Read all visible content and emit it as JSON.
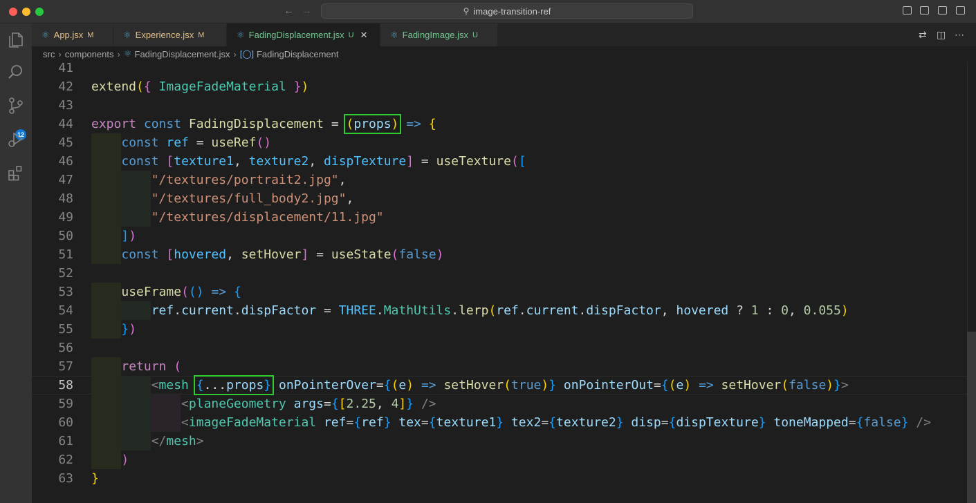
{
  "window": {
    "search": "image-transition-ref"
  },
  "activity_badge": "12",
  "tabs": [
    {
      "name": "App.jsx",
      "status": "M",
      "kind": "modified",
      "active": false
    },
    {
      "name": "Experience.jsx",
      "status": "M",
      "kind": "modified",
      "active": false
    },
    {
      "name": "FadingDisplacement.jsx",
      "status": "U",
      "kind": "untracked",
      "active": true
    },
    {
      "name": "FadingImage.jsx",
      "status": "U",
      "kind": "untracked",
      "active": false
    }
  ],
  "breadcrumb": [
    "src",
    "components",
    "FadingDisplacement.jsx",
    "FadingDisplacement"
  ],
  "line_numbers": [
    "41",
    "42",
    "43",
    "44",
    "45",
    "46",
    "47",
    "48",
    "49",
    "50",
    "51",
    "52",
    "53",
    "54",
    "55",
    "56",
    "57",
    "58",
    "59",
    "60",
    "61",
    "62",
    "63"
  ],
  "current_line": "58",
  "code_lines": [
    [],
    [
      [
        "fn",
        "extend"
      ],
      [
        "b1",
        "("
      ],
      [
        "b2",
        "{"
      ],
      [
        "pl",
        " "
      ],
      [
        "ty",
        "ImageFadeMaterial"
      ],
      [
        "pl",
        " "
      ],
      [
        "b2",
        "}"
      ],
      [
        "b1",
        ")"
      ]
    ],
    [],
    [
      [
        "kw",
        "export"
      ],
      [
        "pl",
        " "
      ],
      [
        "st",
        "const"
      ],
      [
        "pl",
        " "
      ],
      [
        "fn",
        "FadingDisplacement"
      ],
      [
        "pl",
        " = "
      ],
      [
        "b1",
        "("
      ],
      [
        "vr",
        "props"
      ],
      [
        "b1",
        ")"
      ],
      [
        "pl",
        " "
      ],
      [
        "st",
        "=>"
      ],
      [
        "pl",
        " "
      ],
      [
        "b1",
        "{"
      ]
    ],
    [
      [
        "pl",
        "    "
      ],
      [
        "st",
        "const"
      ],
      [
        "pl",
        " "
      ],
      [
        "cn",
        "ref"
      ],
      [
        "pl",
        " = "
      ],
      [
        "fn",
        "useRef"
      ],
      [
        "b2",
        "()"
      ]
    ],
    [
      [
        "pl",
        "    "
      ],
      [
        "st",
        "const"
      ],
      [
        "pl",
        " "
      ],
      [
        "b2",
        "["
      ],
      [
        "cn",
        "texture1"
      ],
      [
        "pl",
        ", "
      ],
      [
        "cn",
        "texture2"
      ],
      [
        "pl",
        ", "
      ],
      [
        "cn",
        "dispTexture"
      ],
      [
        "b2",
        "]"
      ],
      [
        "pl",
        " = "
      ],
      [
        "fn",
        "useTexture"
      ],
      [
        "b2",
        "("
      ],
      [
        "b3",
        "["
      ]
    ],
    [
      [
        "pl",
        "        "
      ],
      [
        "s",
        "\"/textures/portrait2.jpg\""
      ],
      [
        "pl",
        ","
      ]
    ],
    [
      [
        "pl",
        "        "
      ],
      [
        "s",
        "\"/textures/full_body2.jpg\""
      ],
      [
        "pl",
        ","
      ]
    ],
    [
      [
        "pl",
        "        "
      ],
      [
        "s",
        "\"/textures/displacement/11.jpg\""
      ]
    ],
    [
      [
        "pl",
        "    "
      ],
      [
        "b3",
        "]"
      ],
      [
        "b2",
        ")"
      ]
    ],
    [
      [
        "pl",
        "    "
      ],
      [
        "st",
        "const"
      ],
      [
        "pl",
        " "
      ],
      [
        "b2",
        "["
      ],
      [
        "cn",
        "hovered"
      ],
      [
        "pl",
        ", "
      ],
      [
        "fn",
        "setHover"
      ],
      [
        "b2",
        "]"
      ],
      [
        "pl",
        " = "
      ],
      [
        "fn",
        "useState"
      ],
      [
        "b2",
        "("
      ],
      [
        "bo",
        "false"
      ],
      [
        "b2",
        ")"
      ]
    ],
    [],
    [
      [
        "pl",
        "    "
      ],
      [
        "fn",
        "useFrame"
      ],
      [
        "b2",
        "("
      ],
      [
        "b3",
        "()"
      ],
      [
        "pl",
        " "
      ],
      [
        "st",
        "=>"
      ],
      [
        "pl",
        " "
      ],
      [
        "b3",
        "{"
      ]
    ],
    [
      [
        "pl",
        "        "
      ],
      [
        "vr",
        "ref"
      ],
      [
        "pl",
        "."
      ],
      [
        "vr",
        "current"
      ],
      [
        "pl",
        "."
      ],
      [
        "vr",
        "dispFactor"
      ],
      [
        "pl",
        " = "
      ],
      [
        "cn",
        "THREE"
      ],
      [
        "pl",
        "."
      ],
      [
        "ty",
        "MathUtils"
      ],
      [
        "pl",
        "."
      ],
      [
        "fn",
        "lerp"
      ],
      [
        "b1",
        "("
      ],
      [
        "vr",
        "ref"
      ],
      [
        "pl",
        "."
      ],
      [
        "vr",
        "current"
      ],
      [
        "pl",
        "."
      ],
      [
        "vr",
        "dispFactor"
      ],
      [
        "pl",
        ", "
      ],
      [
        "vr",
        "hovered"
      ],
      [
        "pl",
        " ? "
      ],
      [
        "nm",
        "1"
      ],
      [
        "pl",
        " : "
      ],
      [
        "nm",
        "0"
      ],
      [
        "pl",
        ", "
      ],
      [
        "nm",
        "0.055"
      ],
      [
        "b1",
        ")"
      ]
    ],
    [
      [
        "pl",
        "    "
      ],
      [
        "b3",
        "}"
      ],
      [
        "b2",
        ")"
      ]
    ],
    [],
    [
      [
        "pl",
        "    "
      ],
      [
        "kw",
        "return"
      ],
      [
        "pl",
        " "
      ],
      [
        "b2",
        "("
      ]
    ],
    [
      [
        "pl",
        "        "
      ],
      [
        "ang",
        "<"
      ],
      [
        "tg",
        "mesh"
      ],
      [
        "pl",
        " "
      ],
      [
        "b3",
        "{"
      ],
      [
        "pl",
        "..."
      ],
      [
        "vr",
        "props"
      ],
      [
        "b3",
        "}"
      ],
      [
        "pl",
        " "
      ],
      [
        "at",
        "onPointerOver"
      ],
      [
        "pl",
        "="
      ],
      [
        "b3",
        "{"
      ],
      [
        "b1",
        "("
      ],
      [
        "vr",
        "e"
      ],
      [
        "b1",
        ")"
      ],
      [
        "pl",
        " "
      ],
      [
        "st",
        "=>"
      ],
      [
        "pl",
        " "
      ],
      [
        "fn",
        "setHover"
      ],
      [
        "b1",
        "("
      ],
      [
        "bo",
        "true"
      ],
      [
        "b1",
        ")"
      ],
      [
        "b3",
        "}"
      ],
      [
        "pl",
        " "
      ],
      [
        "at",
        "onPointerOut"
      ],
      [
        "pl",
        "="
      ],
      [
        "b3",
        "{"
      ],
      [
        "b1",
        "("
      ],
      [
        "vr",
        "e"
      ],
      [
        "b1",
        ")"
      ],
      [
        "pl",
        " "
      ],
      [
        "st",
        "=>"
      ],
      [
        "pl",
        " "
      ],
      [
        "fn",
        "setHover"
      ],
      [
        "b1",
        "("
      ],
      [
        "bo",
        "false"
      ],
      [
        "b1",
        ")"
      ],
      [
        "b3",
        "}"
      ],
      [
        "ang",
        ">"
      ]
    ],
    [
      [
        "pl",
        "            "
      ],
      [
        "ang",
        "<"
      ],
      [
        "tg",
        "planeGeometry"
      ],
      [
        "pl",
        " "
      ],
      [
        "at",
        "args"
      ],
      [
        "pl",
        "="
      ],
      [
        "b3",
        "{"
      ],
      [
        "b1",
        "["
      ],
      [
        "nm",
        "2.25"
      ],
      [
        "pl",
        ", "
      ],
      [
        "nm",
        "4"
      ],
      [
        "b1",
        "]"
      ],
      [
        "b3",
        "}"
      ],
      [
        "pl",
        " "
      ],
      [
        "ang",
        "/>"
      ]
    ],
    [
      [
        "pl",
        "            "
      ],
      [
        "ang",
        "<"
      ],
      [
        "tg",
        "imageFadeMaterial"
      ],
      [
        "pl",
        " "
      ],
      [
        "at",
        "ref"
      ],
      [
        "pl",
        "="
      ],
      [
        "b3",
        "{"
      ],
      [
        "vr",
        "ref"
      ],
      [
        "b3",
        "}"
      ],
      [
        "pl",
        " "
      ],
      [
        "at",
        "tex"
      ],
      [
        "pl",
        "="
      ],
      [
        "b3",
        "{"
      ],
      [
        "vr",
        "texture1"
      ],
      [
        "b3",
        "}"
      ],
      [
        "pl",
        " "
      ],
      [
        "at",
        "tex2"
      ],
      [
        "pl",
        "="
      ],
      [
        "b3",
        "{"
      ],
      [
        "vr",
        "texture2"
      ],
      [
        "b3",
        "}"
      ],
      [
        "pl",
        " "
      ],
      [
        "at",
        "disp"
      ],
      [
        "pl",
        "="
      ],
      [
        "b3",
        "{"
      ],
      [
        "vr",
        "dispTexture"
      ],
      [
        "b3",
        "}"
      ],
      [
        "pl",
        " "
      ],
      [
        "at",
        "toneMapped"
      ],
      [
        "pl",
        "="
      ],
      [
        "b3",
        "{"
      ],
      [
        "bo",
        "false"
      ],
      [
        "b3",
        "}"
      ],
      [
        "pl",
        " "
      ],
      [
        "ang",
        "/>"
      ]
    ],
    [
      [
        "pl",
        "        "
      ],
      [
        "ang",
        "</"
      ],
      [
        "tg",
        "mesh"
      ],
      [
        "ang",
        ">"
      ]
    ],
    [
      [
        "pl",
        "    "
      ],
      [
        "b2",
        ")"
      ]
    ],
    [
      [
        "b1",
        "}"
      ]
    ]
  ],
  "indent_guides": [
    [],
    [],
    [],
    [],
    [
      1
    ],
    [
      1
    ],
    [
      1,
      2
    ],
    [
      1,
      2
    ],
    [
      1,
      2
    ],
    [
      1
    ],
    [
      1
    ],
    [],
    [
      1
    ],
    [
      1,
      2
    ],
    [
      1
    ],
    [],
    [
      1
    ],
    [
      1,
      2
    ],
    [
      1,
      2,
      3
    ],
    [
      1,
      2,
      3
    ],
    [
      1,
      2
    ],
    [
      1
    ],
    []
  ]
}
